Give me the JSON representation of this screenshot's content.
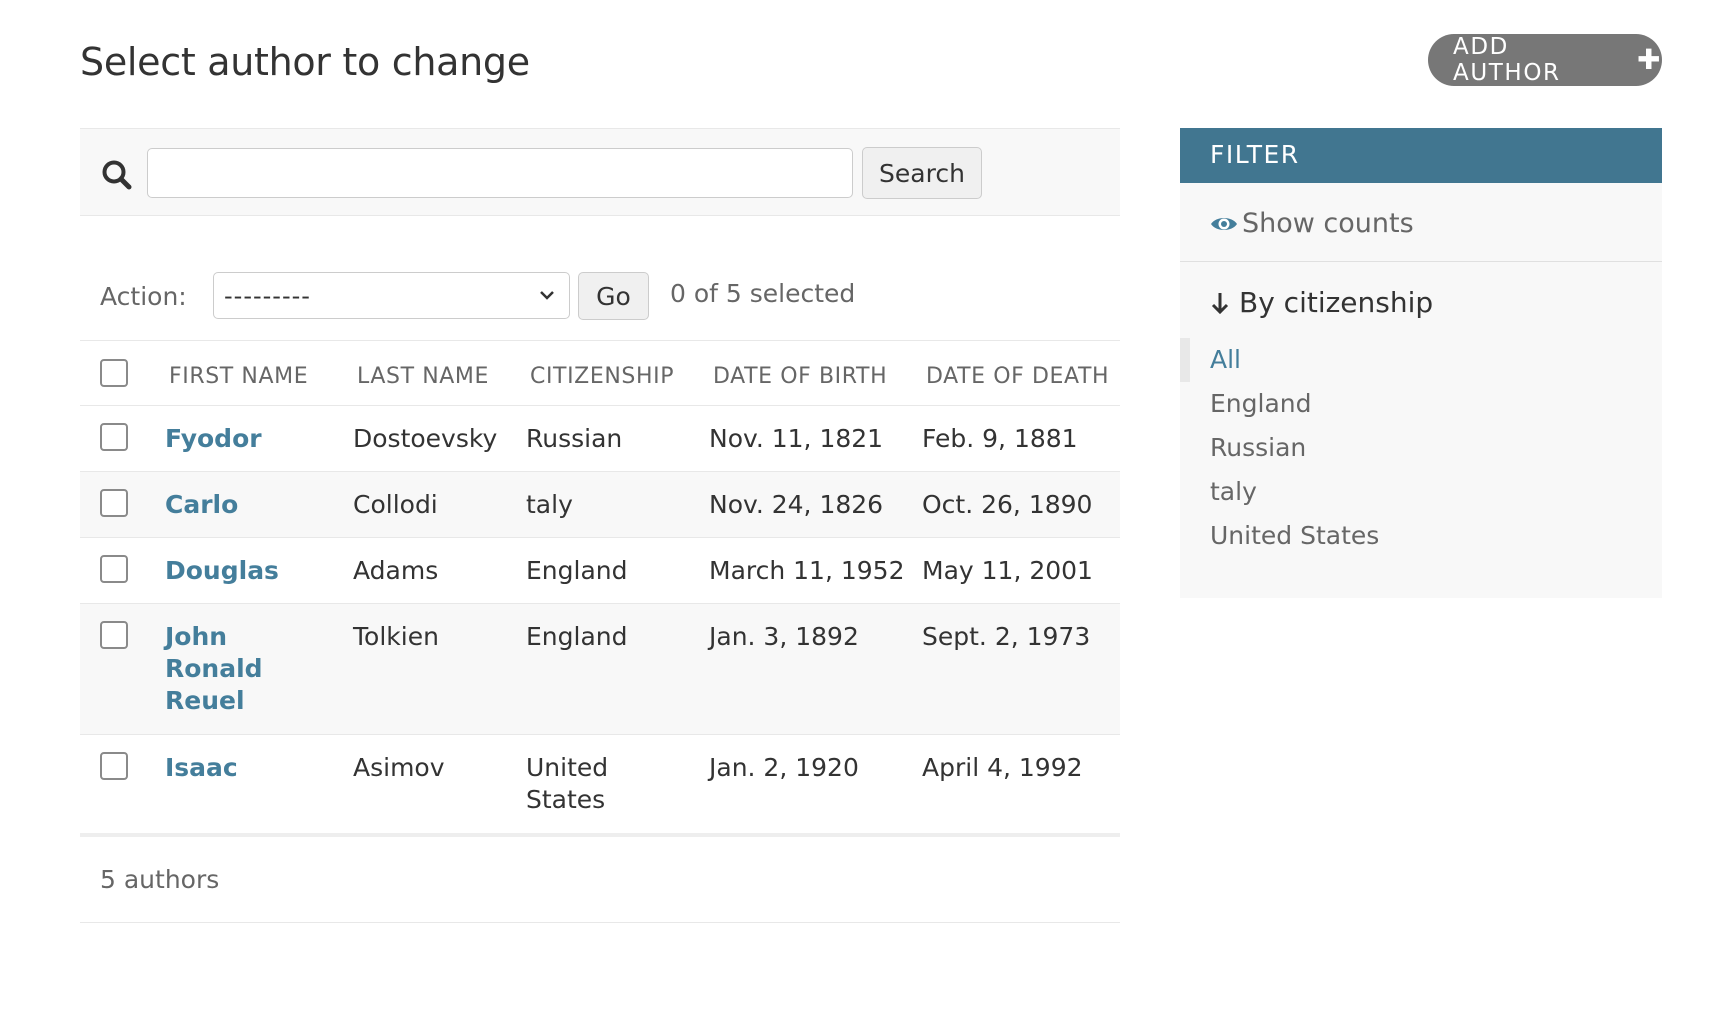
{
  "page_title": "Select author to change",
  "add_button": {
    "label": "ADD AUTHOR",
    "icon": "plus-icon"
  },
  "search": {
    "value": "",
    "placeholder": "",
    "button_label": "Search",
    "icon": "search-icon"
  },
  "actions": {
    "label": "Action:",
    "selected": "---------",
    "go_label": "Go",
    "selection_count": "0 of 5 selected"
  },
  "table": {
    "columns": [
      "FIRST NAME",
      "LAST NAME",
      "CITIZENSHIP",
      "DATE OF BIRTH",
      "DATE OF DEATH"
    ],
    "rows": [
      {
        "first_name": "Fyodor",
        "last_name": "Dostoevsky",
        "citizenship": "Russian",
        "date_of_birth": "Nov. 11, 1821",
        "date_of_death": "Feb. 9, 1881"
      },
      {
        "first_name": "Carlo",
        "last_name": "Collodi",
        "citizenship": "taly",
        "date_of_birth": "Nov. 24, 1826",
        "date_of_death": "Oct. 26, 1890"
      },
      {
        "first_name": "Douglas",
        "last_name": "Adams",
        "citizenship": "England",
        "date_of_birth": "March 11, 1952",
        "date_of_death": "May 11, 2001"
      },
      {
        "first_name": "John Ronald Reuel",
        "last_name": "Tolkien",
        "citizenship": "England",
        "date_of_birth": "Jan. 3, 1892",
        "date_of_death": "Sept. 2, 1973"
      },
      {
        "first_name": "Isaac",
        "last_name": "Asimov",
        "citizenship": "United States",
        "date_of_birth": "Jan. 2, 1920",
        "date_of_death": "April 4, 1992"
      }
    ]
  },
  "paginator": {
    "count_label": "5 authors"
  },
  "filter": {
    "header": "FILTER",
    "show_counts_label": "Show counts",
    "title": "By citizenship",
    "options": [
      {
        "label": "All",
        "selected": true
      },
      {
        "label": "England",
        "selected": false
      },
      {
        "label": "Russian",
        "selected": false
      },
      {
        "label": "taly",
        "selected": false
      },
      {
        "label": "United States",
        "selected": false
      }
    ]
  },
  "colors": {
    "link": "#447e9b",
    "filter_header": "#417690",
    "add_button": "#777777"
  }
}
